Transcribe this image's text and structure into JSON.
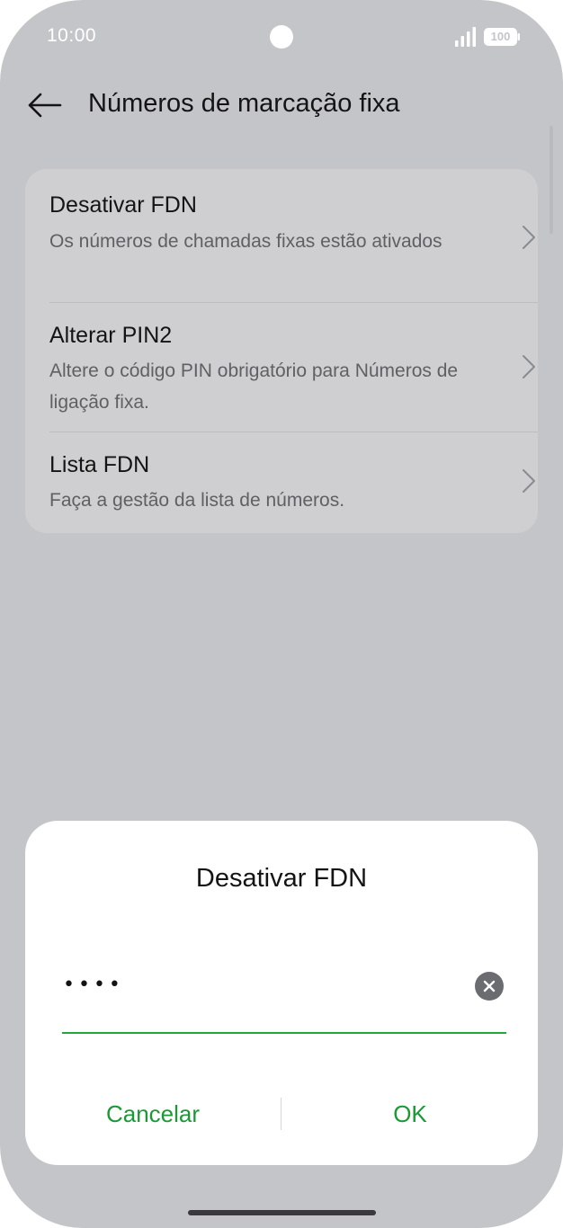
{
  "status_bar": {
    "time": "10:00",
    "battery": "100",
    "icons": [
      "camera-hole",
      "signal-icon",
      "battery-icon"
    ]
  },
  "header": {
    "back_icon": "arrow-left-icon",
    "title": "Números de marcação fixa"
  },
  "settings": {
    "items": [
      {
        "title": "Desativar FDN",
        "subtitle": "Os números de chamadas fixas estão ativados"
      },
      {
        "title": "Alterar PIN2",
        "subtitle": "Altere o código PIN obrigatório para Números de ligação fixa."
      },
      {
        "title": "Lista FDN",
        "subtitle": "Faça a gestão da lista de números."
      }
    ]
  },
  "dialog": {
    "title": "Desativar FDN",
    "pin_value": "••••",
    "clear_icon": "clear-x-icon",
    "cancel_label": "Cancelar",
    "ok_label": "OK"
  },
  "colors": {
    "background": "#c4c5c8",
    "card": "#cfcfd1",
    "dialog": "#ffffff",
    "accent": "#1a9a33",
    "input_underline": "#22a83a"
  }
}
